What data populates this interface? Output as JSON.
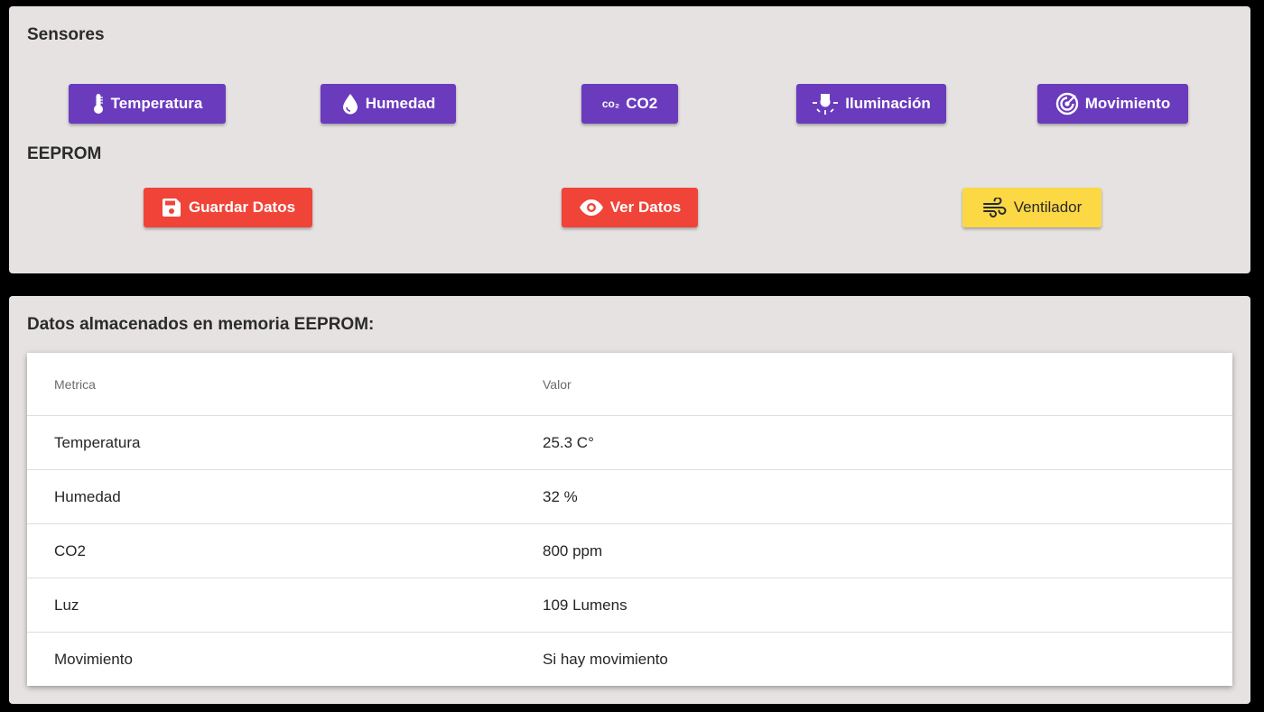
{
  "sensors": {
    "title": "Sensores",
    "buttons": [
      {
        "label": "Temperatura",
        "icon": "thermometer-icon"
      },
      {
        "label": "Humedad",
        "icon": "water-drop-icon"
      },
      {
        "label": "CO2",
        "icon": "co2-icon",
        "icon_text": "co₂"
      },
      {
        "label": "Iluminación",
        "icon": "light-icon"
      },
      {
        "label": "Movimiento",
        "icon": "motion-sensor-icon"
      }
    ]
  },
  "eeprom": {
    "title": "EEPROM",
    "save_label": "Guardar Datos",
    "view_label": "Ver Datos",
    "fan_label": "Ventilador"
  },
  "stored": {
    "title": "Datos almacenados en memoria EEPROM:",
    "headers": [
      "Metrica",
      "Valor"
    ],
    "rows": [
      {
        "metric": "Temperatura",
        "value": "25.3 C°"
      },
      {
        "metric": "Humedad",
        "value": "32 %"
      },
      {
        "metric": "CO2",
        "value": "800 ppm"
      },
      {
        "metric": "Luz",
        "value": "109 Lumens"
      },
      {
        "metric": "Movimiento",
        "value": "Si hay movimiento"
      }
    ]
  },
  "colors": {
    "card_background": "#e6e2e2",
    "sensor_button": "#6a3bbd",
    "eeprom_button": "#f04438",
    "fan_button": "#fcd845",
    "page_background": "#000000"
  }
}
